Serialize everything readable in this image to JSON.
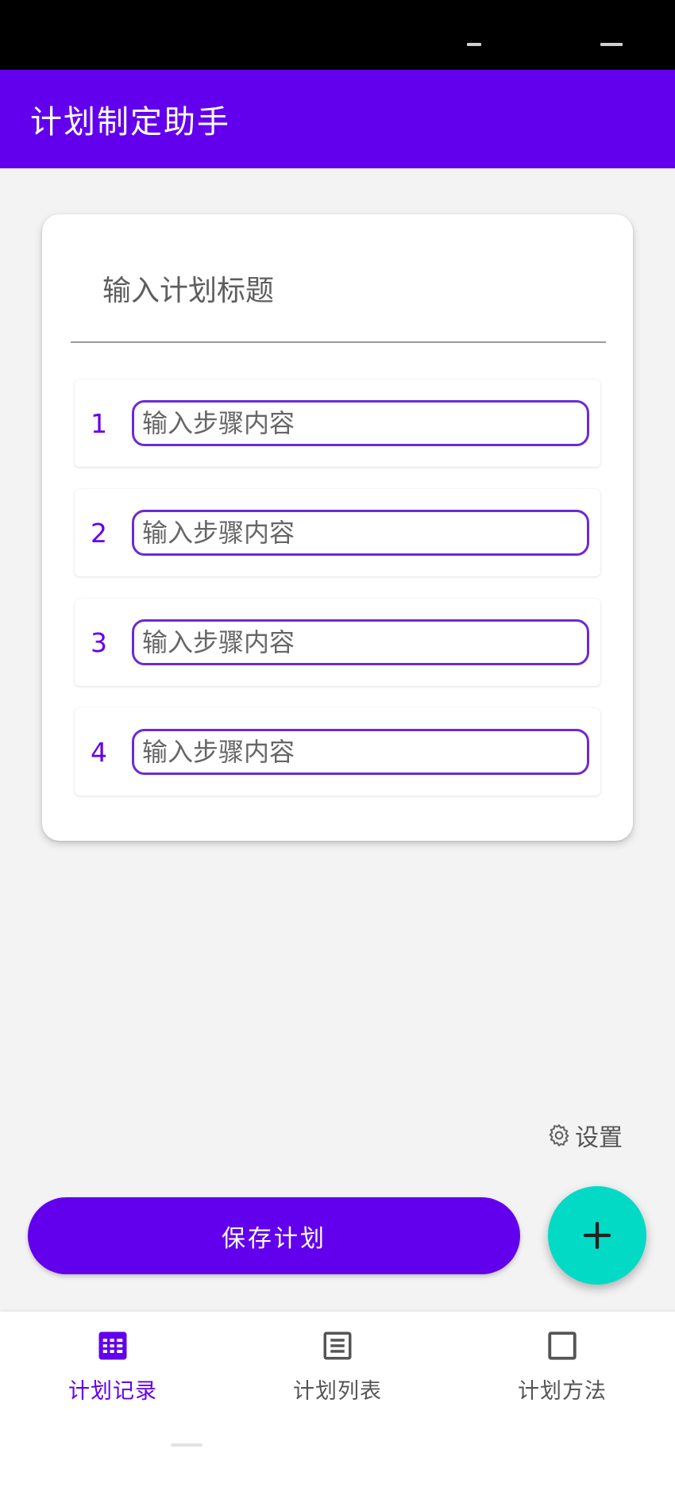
{
  "app": {
    "title": "计划制定助手"
  },
  "plan": {
    "title_placeholder": "输入计划标题",
    "steps": [
      {
        "number": "1",
        "placeholder": "输入步骤内容"
      },
      {
        "number": "2",
        "placeholder": "输入步骤内容"
      },
      {
        "number": "3",
        "placeholder": "输入步骤内容"
      },
      {
        "number": "4",
        "placeholder": "输入步骤内容"
      }
    ]
  },
  "actions": {
    "settings_label": "设置",
    "settings_icon": "gear-icon",
    "save_label": "保存计划",
    "add_icon": "plus-icon"
  },
  "bottom_nav": {
    "items": [
      {
        "label": "计划记录",
        "icon": "grid-list-icon",
        "active": true
      },
      {
        "label": "计划列表",
        "icon": "list-icon",
        "active": false
      },
      {
        "label": "计划方法",
        "icon": "square-icon",
        "active": false
      }
    ]
  },
  "colors": {
    "primary": "#6200ee",
    "accent": "#03dac5",
    "background": "#f3f3f4"
  }
}
